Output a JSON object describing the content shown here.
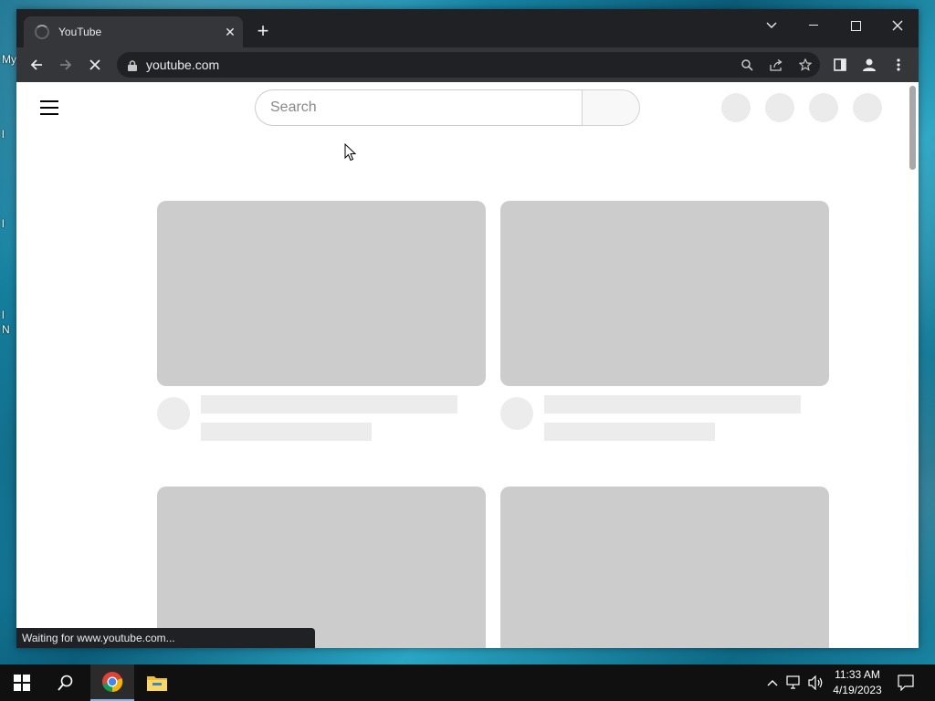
{
  "desktop": {
    "edge_labels": [
      "My",
      "l",
      "l",
      "l",
      "N"
    ]
  },
  "browser": {
    "tab": {
      "title": "YouTube",
      "close_glyph": "✕"
    },
    "new_tab_glyph": "+",
    "window_controls": {
      "dropdown_glyph": "⌄",
      "minimize_glyph": "─",
      "maximize_glyph": "☐",
      "close_glyph": "✕"
    },
    "toolbar": {
      "back_glyph": "←",
      "forward_glyph": "→",
      "stop_glyph": "✕",
      "url": "youtube.com"
    },
    "status_text": "Waiting for www.youtube.com..."
  },
  "youtube": {
    "search_placeholder": "Search"
  },
  "taskbar": {
    "time": "11:33 AM",
    "date": "4/19/2023"
  }
}
